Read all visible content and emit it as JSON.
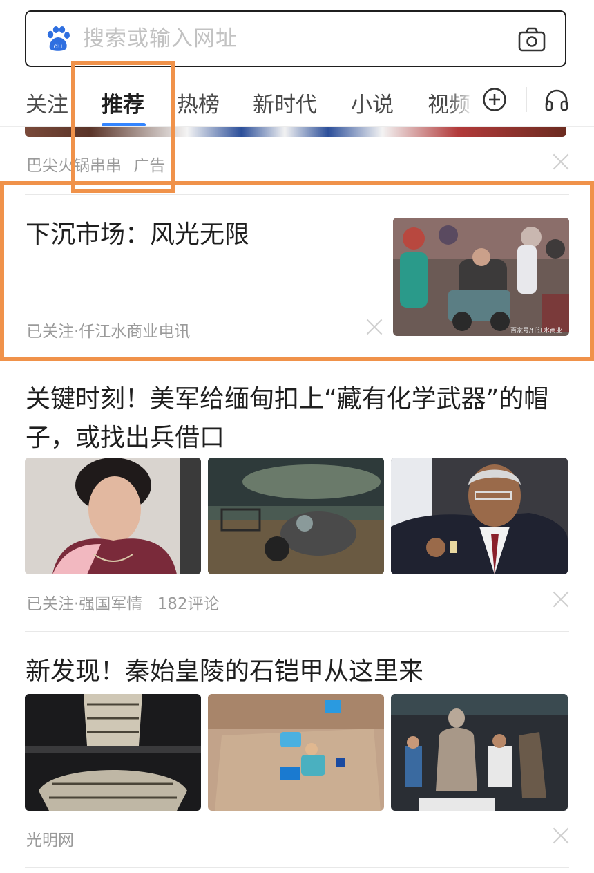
{
  "search": {
    "placeholder": "搜索或输入网址",
    "logo_icon": "baidu-paw-icon",
    "camera_icon": "camera-icon"
  },
  "tabs": [
    {
      "label": "关注",
      "active": false
    },
    {
      "label": "推荐",
      "active": true
    },
    {
      "label": "热榜",
      "active": false
    },
    {
      "label": "新时代",
      "active": false
    },
    {
      "label": "小说",
      "active": false
    },
    {
      "label": "视频",
      "active": false
    }
  ],
  "tab_actions": {
    "add_icon": "plus-circle-icon",
    "listen_icon": "headphones-icon"
  },
  "feed": {
    "ad": {
      "source": "巴尖火锅串串",
      "tag": "广告"
    },
    "article1": {
      "title": "下沉市场：风光无限",
      "meta": "已关注·仟江水商业电讯",
      "image_caption": "百家号/仟江水商业"
    },
    "article2": {
      "title": "关键时刻！美军给缅甸扣上“藏有化学武器”的帽子，或找出兵借口",
      "meta": "已关注·强国军情",
      "comments": "182评论"
    },
    "article3": {
      "title": "新发现！秦始皇陵的石铠甲从这里来",
      "meta": "光明网"
    }
  },
  "colors": {
    "accent": "#3385ff",
    "highlight": "#f0924a",
    "text": "#1f1f1f",
    "meta": "#9a9a9a"
  }
}
